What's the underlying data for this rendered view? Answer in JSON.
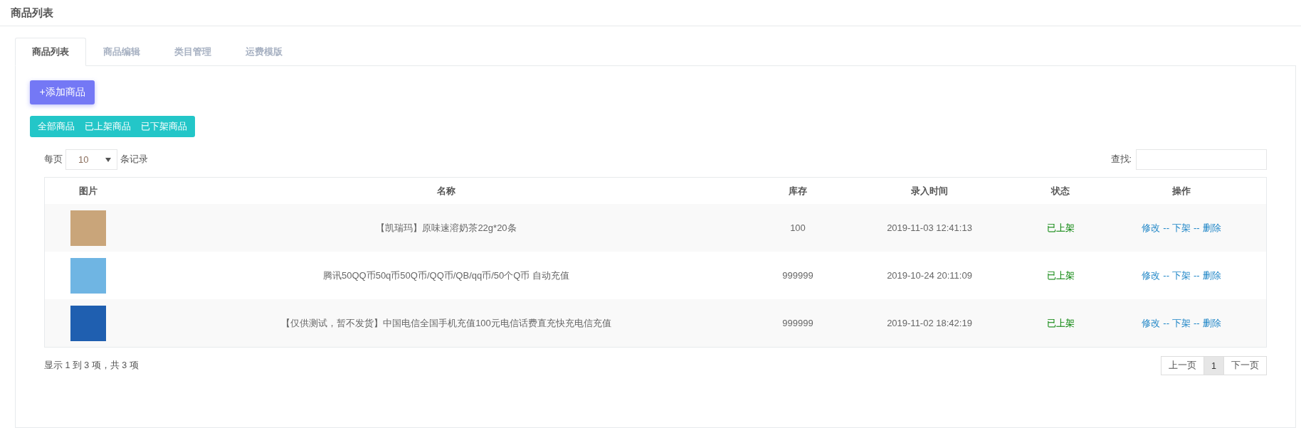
{
  "page_title": "商品列表",
  "tabs": [
    {
      "label": "商品列表",
      "selected": true
    },
    {
      "label": "商品编辑",
      "selected": false
    },
    {
      "label": "类目管理",
      "selected": false
    },
    {
      "label": "运费模版",
      "selected": false
    }
  ],
  "add_button": "+添加商品",
  "filters": [
    "全部商品",
    "已上架商品",
    "已下架商品"
  ],
  "page_size": {
    "before": "每页",
    "value": "10",
    "after": "条记录"
  },
  "search": {
    "label": "查找:"
  },
  "table": {
    "columns": [
      "图片",
      "名称",
      "库存",
      "录入时间",
      "状态",
      "操作"
    ],
    "rows": [
      {
        "name": "【凯瑞玛】原味速溶奶茶22g*20条",
        "stock": "100",
        "time": "2019-11-03 12:41:13",
        "status": "已上架",
        "listed": true,
        "actions": [
          "修改",
          "下架",
          "删除"
        ],
        "separators": [
          "--",
          "--"
        ]
      },
      {
        "name": "腾讯50QQ币50q币50Q币/QQ币/QB/qq币/50个Q币 自动充值",
        "stock": "999999",
        "time": "2019-10-24 20:11:09",
        "status": "已上架",
        "listed": true,
        "actions": [
          "修改",
          "下架",
          "删除"
        ],
        "separators": [
          "--",
          "--"
        ]
      },
      {
        "name": "【仅供测试，暂不发货】中国电信全国手机充值100元电信话费直充快充电信充值",
        "stock": "999999",
        "time": "2019-11-02 18:42:19",
        "status": "已上架",
        "listed": true,
        "actions": [
          "修改",
          "下架",
          "删除"
        ],
        "separators": [
          "--",
          "--"
        ]
      }
    ]
  },
  "info": "显示 1 到 3 项，共 3 项",
  "pagination": [
    {
      "label": "上一页",
      "selected": false
    },
    {
      "label": "1",
      "selected": true
    },
    {
      "label": "下一页",
      "selected": false
    }
  ]
}
